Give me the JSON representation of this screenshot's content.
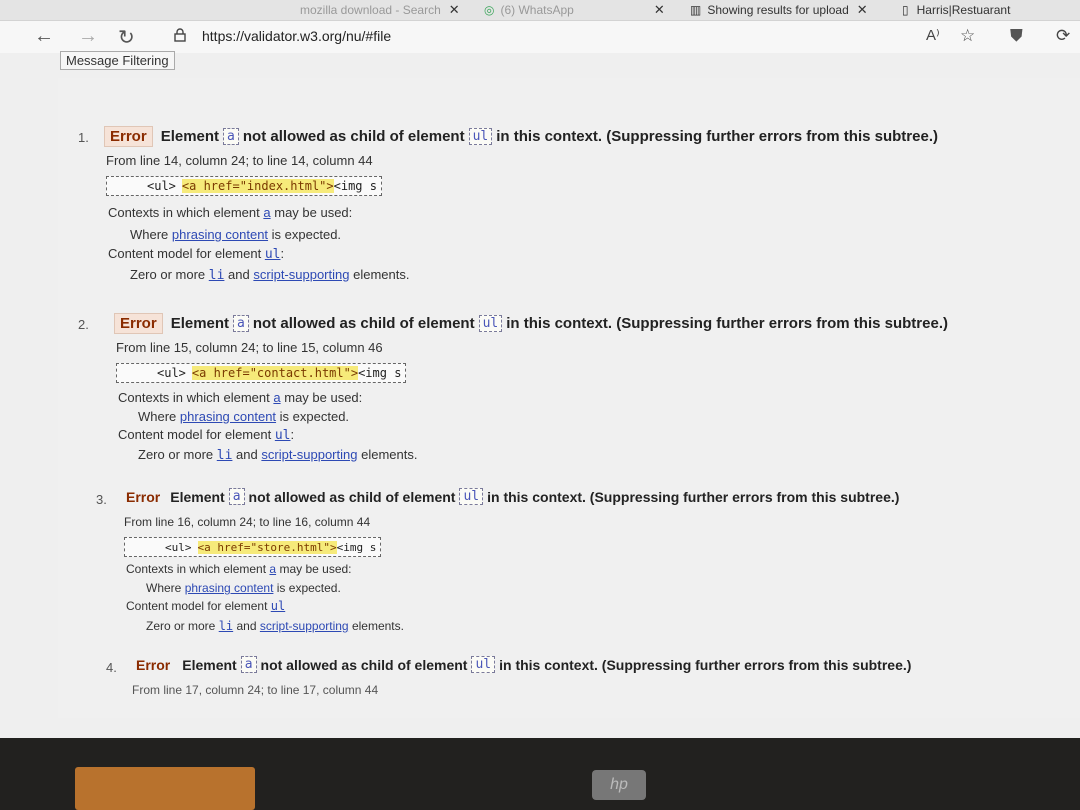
{
  "browser": {
    "tabs": [
      {
        "label": "mozilla download - Search"
      },
      {
        "label": "(6) WhatsApp"
      },
      {
        "label": "Showing results for upload"
      },
      {
        "label": "Harris|Restuarant"
      }
    ],
    "address": "https://validator.w3.org/nu/#file",
    "icons": {
      "back": "back-arrow-icon",
      "forward": "forward-arrow-icon",
      "refresh": "refresh-icon",
      "lock": "lock-icon",
      "read_aloud": "read-aloud-icon",
      "favorites": "favorites-star-icon",
      "shield": "shield-icon",
      "extension": "extension-icon"
    }
  },
  "filter_tab": "Message Filtering",
  "messages": [
    {
      "num": "1.",
      "badge": "Error",
      "element_word": "Element",
      "el": "a",
      "mid": "not allowed as child of element",
      "parent": "ul",
      "tail": "in this context. (Suppressing further errors from this subtree.)",
      "location": "From line 14, column 24; to line 14, column 44",
      "extract_pre": "<ul>",
      "extract_hl": "<a href=\"index.html\">",
      "extract_post": "<img s",
      "contexts_label_1": "Contexts in which element",
      "contexts_label_2": "may be used:",
      "where_1": "Where",
      "where_link": "phrasing content",
      "where_2": "is expected.",
      "model_label": "Content model for element",
      "zero_1": "Zero or more",
      "zero_li": "li",
      "zero_and": "and",
      "zero_link": "script-supporting",
      "zero_2": "elements."
    },
    {
      "num": "2.",
      "badge": "Error",
      "element_word": "Element",
      "el": "a",
      "mid": "not allowed as child of element",
      "parent": "ul",
      "tail": "in this context. (Suppressing further errors from this subtree.)",
      "location": "From line 15, column 24; to line 15, column 46",
      "extract_pre": "<ul>",
      "extract_hl": "<a href=\"contact.html\">",
      "extract_post": "<img s",
      "contexts_label_1": "Contexts in which element",
      "contexts_label_2": "may be used:",
      "where_1": "Where",
      "where_link": "phrasing content",
      "where_2": "is expected.",
      "model_label": "Content model for element",
      "zero_1": "Zero or more",
      "zero_li": "li",
      "zero_and": "and",
      "zero_link": "script-supporting",
      "zero_2": "elements."
    },
    {
      "num": "3.",
      "badge": "Error",
      "element_word": "Element",
      "el": "a",
      "mid": "not allowed as child of element",
      "parent": "ul",
      "tail": "in this context. (Suppressing further errors from this subtree.)",
      "location": "From line 16, column 24; to line 16, column 44",
      "extract_pre": "<ul>",
      "extract_hl": "<a href=\"store.html\">",
      "extract_post": "<img s",
      "contexts_label_1": "Contexts in which element",
      "contexts_label_2": "may be used:",
      "where_1": "Where",
      "where_link": "phrasing content",
      "where_2": "is expected.",
      "model_label": "Content model for element",
      "zero_1": "Zero or more",
      "zero_li": "li",
      "zero_and": "and",
      "zero_link": "script-supporting",
      "zero_2": "elements."
    },
    {
      "num": "4.",
      "badge": "Error",
      "element_word": "Element",
      "el": "a",
      "mid": "not allowed as child of element",
      "parent": "ul",
      "tail": "in this context. (Suppressing further errors from this subtree.)",
      "location": "From line 17, column 24; to line 17, column 44"
    }
  ],
  "colors": {
    "link": "#2d49b4",
    "error_badge_bg": "#f6e3d8",
    "extract_highlight": "#f6ea7a"
  }
}
